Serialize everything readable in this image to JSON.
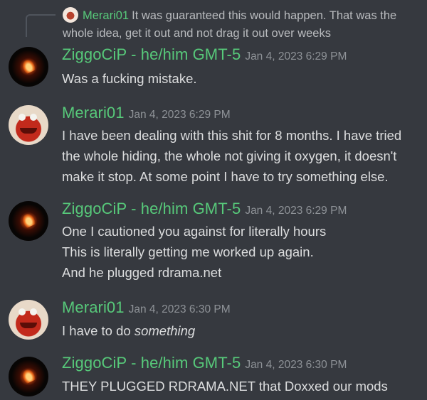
{
  "reply": {
    "author": "Merari01",
    "text": "It was guaranteed this would happen. That was the whole idea, get it out and not drag it out over weeks"
  },
  "messages": [
    {
      "author": "ZiggoCiP - he/him GMT-5",
      "timestamp": "Jan 4, 2023 6:29 PM",
      "avatar": "fire-avatar",
      "lines": [
        "Was a fucking mistake."
      ]
    },
    {
      "author": "Merari01",
      "timestamp": "Jan 4, 2023 6:29 PM",
      "avatar": "muppet-avatar",
      "lines": [
        "I have been dealing with this shit for 8 months. I have tried the whole hiding, the whole not giving it oxygen, it doesn't make it stop. At some point I have to try something else."
      ]
    },
    {
      "author": "ZiggoCiP - he/him GMT-5",
      "timestamp": "Jan 4, 2023 6:29 PM",
      "avatar": "fire-avatar",
      "lines": [
        "One I cautioned you against for literally hours",
        "This is literally getting me worked up again.",
        "And he plugged rdrama.net"
      ]
    },
    {
      "author": "Merari01",
      "timestamp": "Jan 4, 2023 6:30 PM",
      "avatar": "muppet-avatar",
      "lines": [
        "I have to do "
      ],
      "emphasis": "something"
    },
    {
      "author": "ZiggoCiP - he/him GMT-5",
      "timestamp": "Jan 4, 2023 6:30 PM",
      "avatar": "fire-avatar",
      "lines": [
        "THEY PLUGGED RDRAMA.NET that Doxxed our mods"
      ]
    }
  ]
}
